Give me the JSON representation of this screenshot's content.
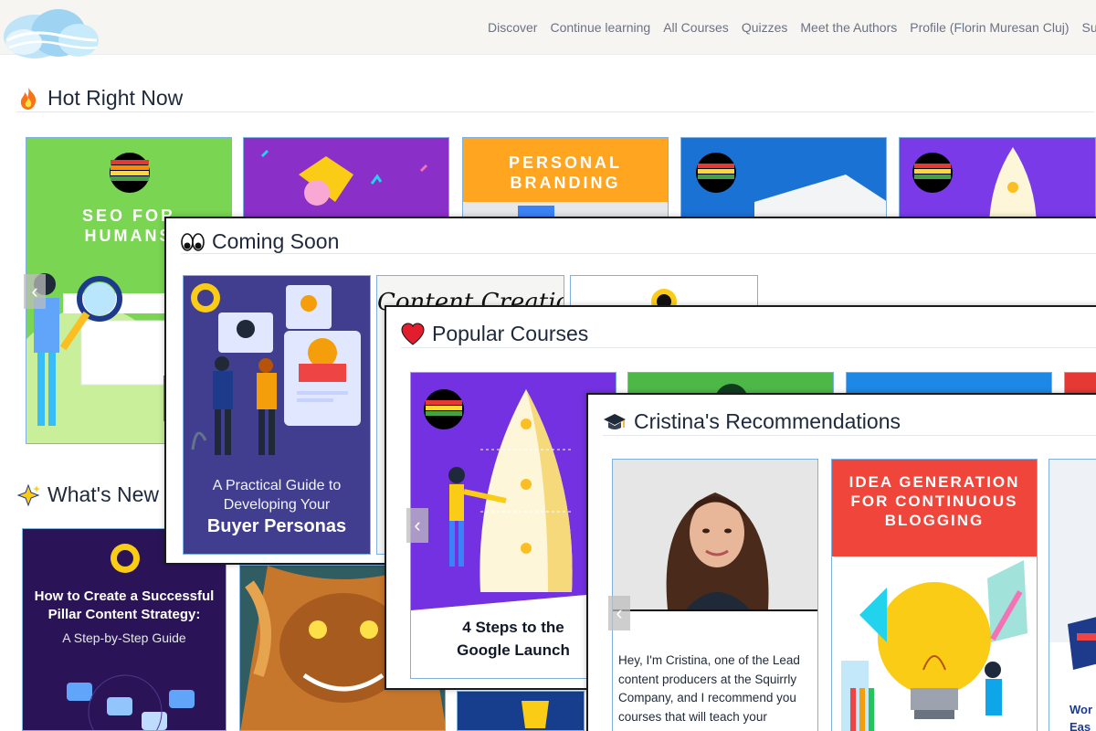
{
  "nav": {
    "links": [
      "Discover",
      "Continue learning",
      "All Courses",
      "Quizzes",
      "Meet the Authors",
      "Profile (Florin Muresan Cluj)",
      "Support"
    ]
  },
  "sections": {
    "hot": {
      "title": "Hot Right Now"
    },
    "whats_new": {
      "title": "What's New"
    },
    "coming_soon": {
      "title": "Coming Soon"
    },
    "popular": {
      "title": "Popular Courses"
    },
    "cristina": {
      "title": "Cristina's Recommendations"
    }
  },
  "cards": {
    "seo_title": "SEO FOR HUMANS",
    "personal_branding": "PERSONAL BRANDING",
    "buyer_personas_line1": "A Practical Guide to",
    "buyer_personas_line2": "Developing Your",
    "buyer_personas_line3": "Buyer Personas",
    "content_creation": "Content Creation",
    "four_steps": "4 Steps to the Google Launch",
    "pillar_line1": "How to Create a Successful",
    "pillar_line2": "Pillar Content Strategy:",
    "pillar_line3": "A Step-by-Step Guide",
    "idea_generation": "IDEA GENERATION FOR CONTINUOUS BLOGGING",
    "cristina_bio": "Hey, I'm Cristina, one of the Lead content producers at the Squirrly Company, and I recommend you courses that will teach your",
    "partial_word": "Wor Eas"
  },
  "icons": {
    "fire": "fire-icon",
    "eyes": "eyes-icon",
    "heart": "heart-icon",
    "sparkles": "sparkles-icon",
    "grad_cap": "graduation-cap-icon",
    "prev": "chevron-left-icon"
  },
  "colors": {
    "card_border": "#7fb0e0",
    "nav_bg": "#f6f5f2",
    "heart": "#e11d2e"
  }
}
